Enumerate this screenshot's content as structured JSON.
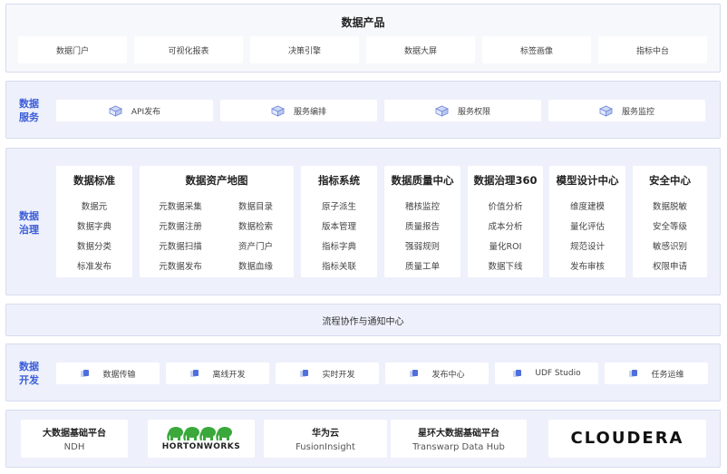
{
  "products": {
    "title": "数据产品",
    "items": [
      "数据门户",
      "可视化报表",
      "决策引擎",
      "数据大屏",
      "标签画像",
      "指标中台"
    ]
  },
  "service": {
    "label_line1": "数据",
    "label_line2": "服务",
    "items": [
      "API发布",
      "服务编排",
      "服务权限",
      "服务监控"
    ]
  },
  "governance": {
    "label_line1": "数据",
    "label_line2": "治理",
    "columns": [
      {
        "title": "数据标准",
        "items": [
          "数据元",
          "数据字典",
          "数据分类",
          "标准发布"
        ]
      },
      {
        "title": "数据资产地图",
        "left": [
          "元数据采集",
          "元数据注册",
          "元数据扫描",
          "元数据发布"
        ],
        "right": [
          "数据目录",
          "数据检索",
          "资产门户",
          "数据血缘"
        ]
      },
      {
        "title": "指标系统",
        "items": [
          "原子派生",
          "版本管理",
          "指标字典",
          "指标关联"
        ]
      },
      {
        "title": "数据质量中心",
        "items": [
          "稽核监控",
          "质量报告",
          "强弱规则",
          "质量工单"
        ]
      },
      {
        "title": "数据治理360",
        "items": [
          "价值分析",
          "成本分析",
          "量化ROI",
          "数据下线"
        ]
      },
      {
        "title": "模型设计中心",
        "items": [
          "维度建模",
          "量化评估",
          "规范设计",
          "发布审核"
        ]
      },
      {
        "title": "安全中心",
        "items": [
          "数据脱敏",
          "安全等级",
          "敏感识别",
          "权限申请"
        ]
      }
    ]
  },
  "workflow": {
    "title": "流程协作与通知中心"
  },
  "dev": {
    "label_line1": "数据",
    "label_line2": "开发",
    "items": [
      "数据传输",
      "离线开发",
      "实时开发",
      "发布中心",
      "UDF Studio",
      "任务运维"
    ]
  },
  "base": {
    "items": [
      {
        "title": "大数据基础平台",
        "sub": "NDH"
      },
      {
        "logo": "HORTONWORKS"
      },
      {
        "title": "华为云",
        "sub": "FusionInsight"
      },
      {
        "title": "星环大数据基础平台",
        "sub": "Transwarp Data Hub"
      },
      {
        "logo": "CLOUDERA"
      }
    ]
  },
  "colors": {
    "accent": "#3a5cd8",
    "layer_bg": "#eef1fb",
    "hortonworks_green": "#3aa83a"
  }
}
